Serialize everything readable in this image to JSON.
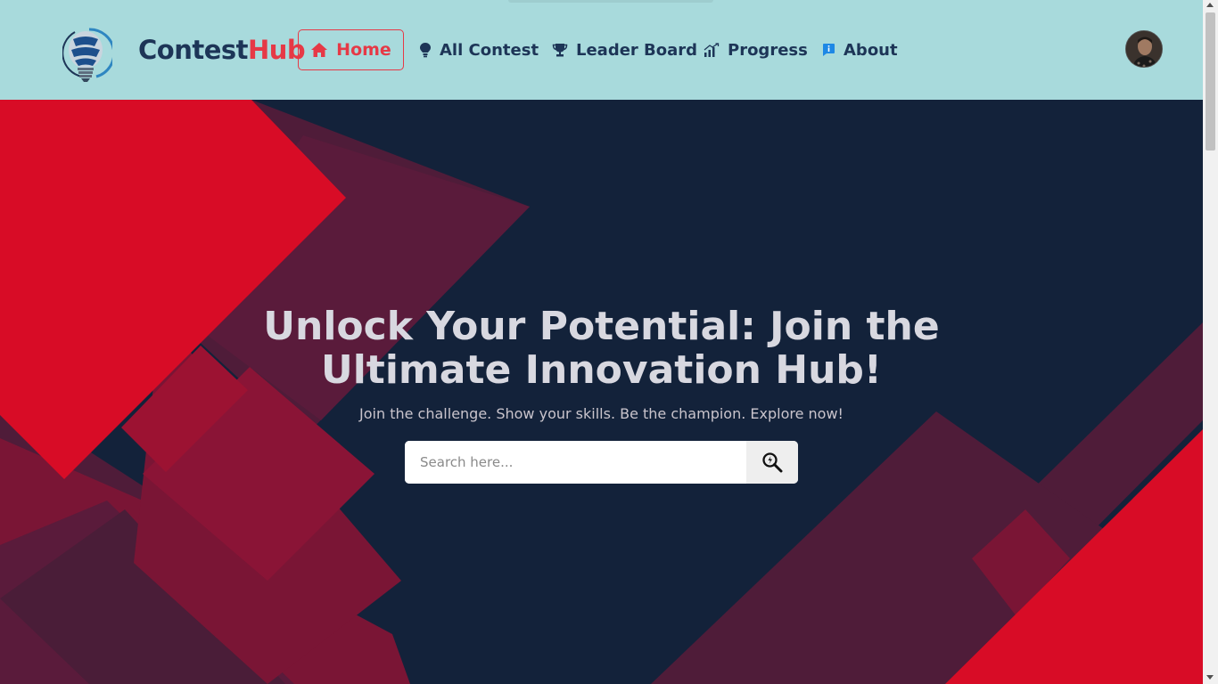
{
  "brand": {
    "part1": "Contest",
    "part2": "Hub"
  },
  "nav": {
    "home": "Home",
    "all_contest": "All Contest",
    "leader_board": "Leader Board",
    "progress": "Progress",
    "about": "About"
  },
  "hero": {
    "title_line1": "Unlock Your Potential: Join the",
    "title_line2": "Ultimate Innovation Hub!",
    "subtitle": "Join the challenge. Show your skills. Be the champion. Explore now!"
  },
  "search": {
    "placeholder": "Search here...",
    "value": ""
  },
  "colors": {
    "navbar_bg": "#a8dadc",
    "brand_dark": "#1d3557",
    "accent_red": "#e63946",
    "hero_bg": "#13223a"
  },
  "icons": {
    "logo": "lightbulb-logo-icon",
    "home": "home-icon",
    "all_contest": "lightbulb-icon",
    "leader_board": "trophy-icon",
    "progress": "signal-chart-icon",
    "about": "info-icon",
    "search": "search-icon"
  }
}
